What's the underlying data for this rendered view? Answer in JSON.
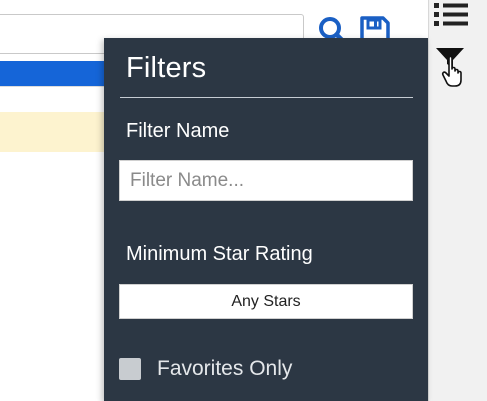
{
  "filters": {
    "title": "Filters",
    "filter_name_label": "Filter Name",
    "filter_name_placeholder": "Filter Name...",
    "filter_name_value": "",
    "min_star_label": "Minimum Star Rating",
    "min_star_selected": "Any Stars",
    "favorites_label": "Favorites Only",
    "favorites_checked": false
  },
  "toolbar": {
    "icons": [
      "search-icon",
      "save-icon"
    ]
  },
  "rail": {
    "icons": [
      "list-icon",
      "filter-icon",
      "hand-cursor-icon"
    ]
  },
  "colors": {
    "panel_bg": "#2c3744",
    "selected_row": "#1565d8",
    "highlight_row": "#fdf3cf",
    "icon_blue": "#1a5fc4"
  }
}
